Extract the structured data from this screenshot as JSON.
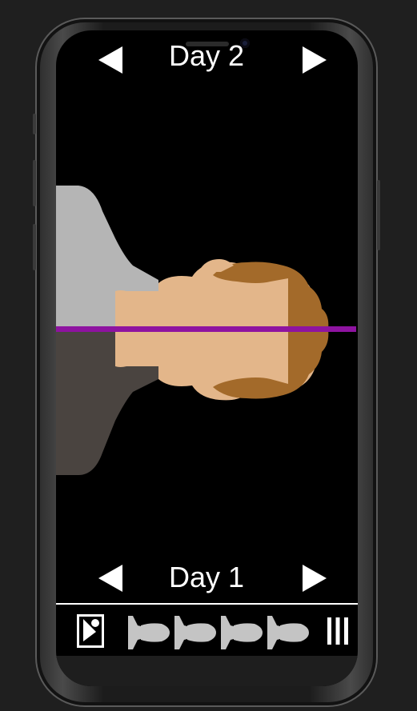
{
  "header": {
    "day_label": "Day 2",
    "prev_icon": "triangle-left-icon",
    "next_icon": "triangle-right-icon"
  },
  "footer": {
    "day_label": "Day 1",
    "prev_icon": "triangle-left-icon",
    "next_icon": "triangle-right-icon"
  },
  "toolbar": {
    "items": [
      {
        "icon": "photo-frame-icon"
      },
      {
        "icon": "head-thumbnail-icon"
      },
      {
        "icon": "head-thumbnail-icon"
      },
      {
        "icon": "head-thumbnail-icon"
      },
      {
        "icon": "head-thumbnail-icon"
      },
      {
        "icon": "menu-bars-icon"
      }
    ]
  },
  "colors": {
    "background": "#000000",
    "skin": "#e3b68a",
    "hair": "#a36a2a",
    "shirt_top": "#b5b5b5",
    "shirt_bottom": "#4a4440",
    "guide_line": "#8e13a0",
    "thumbnail": "#c4c4c4"
  }
}
